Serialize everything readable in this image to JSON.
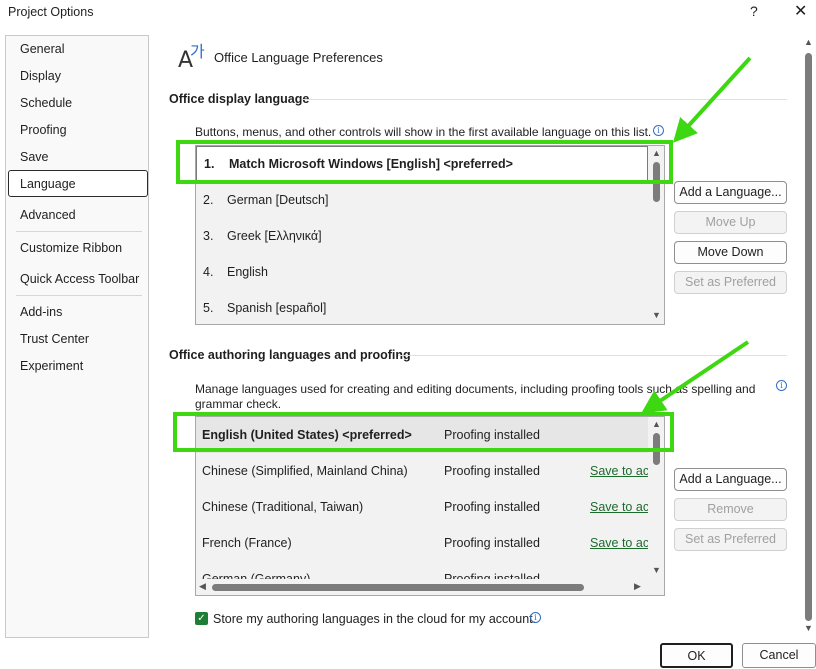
{
  "window": {
    "title": "Project Options",
    "help_label": "?",
    "close_label": "✕"
  },
  "nav": {
    "items": [
      "General",
      "Display",
      "Schedule",
      "Proofing",
      "Save",
      "Language",
      "Advanced",
      "Customize Ribbon",
      "Quick Access Toolbar",
      "Add-ins",
      "Trust Center",
      "Experiment"
    ],
    "selected": "Language"
  },
  "header": {
    "title": "Office Language Preferences",
    "icon": "language-icon",
    "icon_glyph_a": "A",
    "icon_glyph_b": "가"
  },
  "display_language": {
    "heading": "Office display language",
    "description": "Buttons, menus, and other controls will show in the first available language on this list.",
    "items": [
      {
        "num": "1.",
        "label": "Match Microsoft Windows [English] <preferred>"
      },
      {
        "num": "2.",
        "label": "German [Deutsch]"
      },
      {
        "num": "3.",
        "label": "Greek [Ελληνικά]"
      },
      {
        "num": "4.",
        "label": "English"
      },
      {
        "num": "5.",
        "label": "Spanish [español]"
      }
    ],
    "buttons": {
      "add": "Add a Language...",
      "move_up": "Move Up",
      "move_down": "Move Down",
      "set_preferred": "Set as Preferred"
    }
  },
  "authoring": {
    "heading": "Office authoring languages and proofing",
    "description": "Manage languages used for creating and editing documents, including proofing tools such as spelling and grammar check.",
    "rows": [
      {
        "language": "English (United States) <preferred>",
        "status": "Proofing installed",
        "action": ""
      },
      {
        "language": "Chinese (Simplified, Mainland China)",
        "status": "Proofing installed",
        "action": "Save to acc"
      },
      {
        "language": "Chinese (Traditional, Taiwan)",
        "status": "Proofing installed",
        "action": "Save to acc"
      },
      {
        "language": "French (France)",
        "status": "Proofing installed",
        "action": "Save to acc"
      },
      {
        "language": "German (Germany)",
        "status": "Proofing installed",
        "action": ""
      }
    ],
    "buttons": {
      "add": "Add a Language...",
      "remove": "Remove",
      "set_preferred": "Set as Preferred"
    },
    "cloud_checkbox": {
      "label": "Store my authoring languages in the cloud for my account.",
      "checked": true
    }
  },
  "footer": {
    "ok": "OK",
    "cancel": "Cancel"
  },
  "colors": {
    "annotation": "#3ed812",
    "checkbox": "#1e7e34",
    "link": "#1e6b2e"
  }
}
